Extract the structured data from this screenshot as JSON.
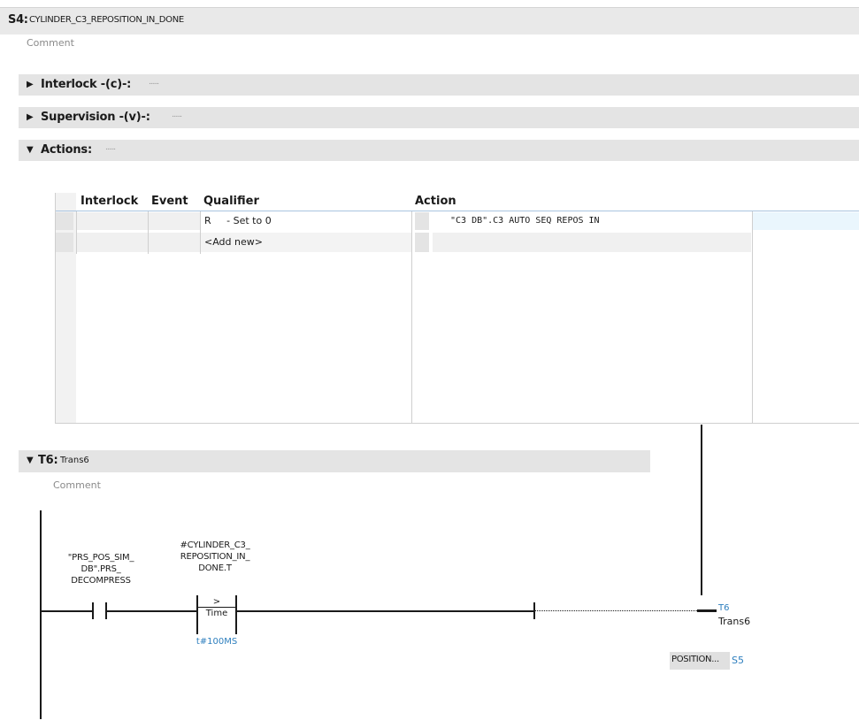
{
  "step": {
    "id": "S4:",
    "name": "CYLINDER_C3_REPOSITION_IN_DONE",
    "comment": "Comment"
  },
  "sections": [
    {
      "toggle": "▶",
      "label": "Interlock -(c)-:",
      "dots": "......"
    },
    {
      "toggle": "▶",
      "label": "Supervision -(v)-:",
      "dots": "......"
    },
    {
      "toggle": "▼",
      "label": "Actions:",
      "dots": "......"
    }
  ],
  "actions_table": {
    "columns": [
      "Interlock",
      "Event",
      "Qualifier",
      "Action"
    ],
    "rows": [
      {
        "qualifier": "R     - Set to 0",
        "action": "\"C3 DB\".C3 AUTO SEQ REPOS IN"
      },
      {
        "qualifier": "<Add new>",
        "action": ""
      }
    ]
  },
  "transition": {
    "toggle": "▼",
    "id": "T6:",
    "name": "Trans6",
    "comment": "Comment"
  },
  "ladder": {
    "contact_operand": "\"PRS_POS_SIM_\nDB\".PRS_\nDECOMPRESS",
    "compare_operand": "#CYLINDER_C3_\nREPOSITION_IN_\nDONE.T",
    "compare_op": ">",
    "compare_type": "Time",
    "compare_value": "t#100MS",
    "trans_id": "T6",
    "trans_name": "Trans6",
    "next_label": "POSITION...",
    "next_step": "S5"
  },
  "colors": {
    "accent_blue": "#2e7fbe",
    "section_bg": "#e4e4e4",
    "header_bg": "#e9e9e9",
    "row_highlight": "#eaf6fd"
  }
}
